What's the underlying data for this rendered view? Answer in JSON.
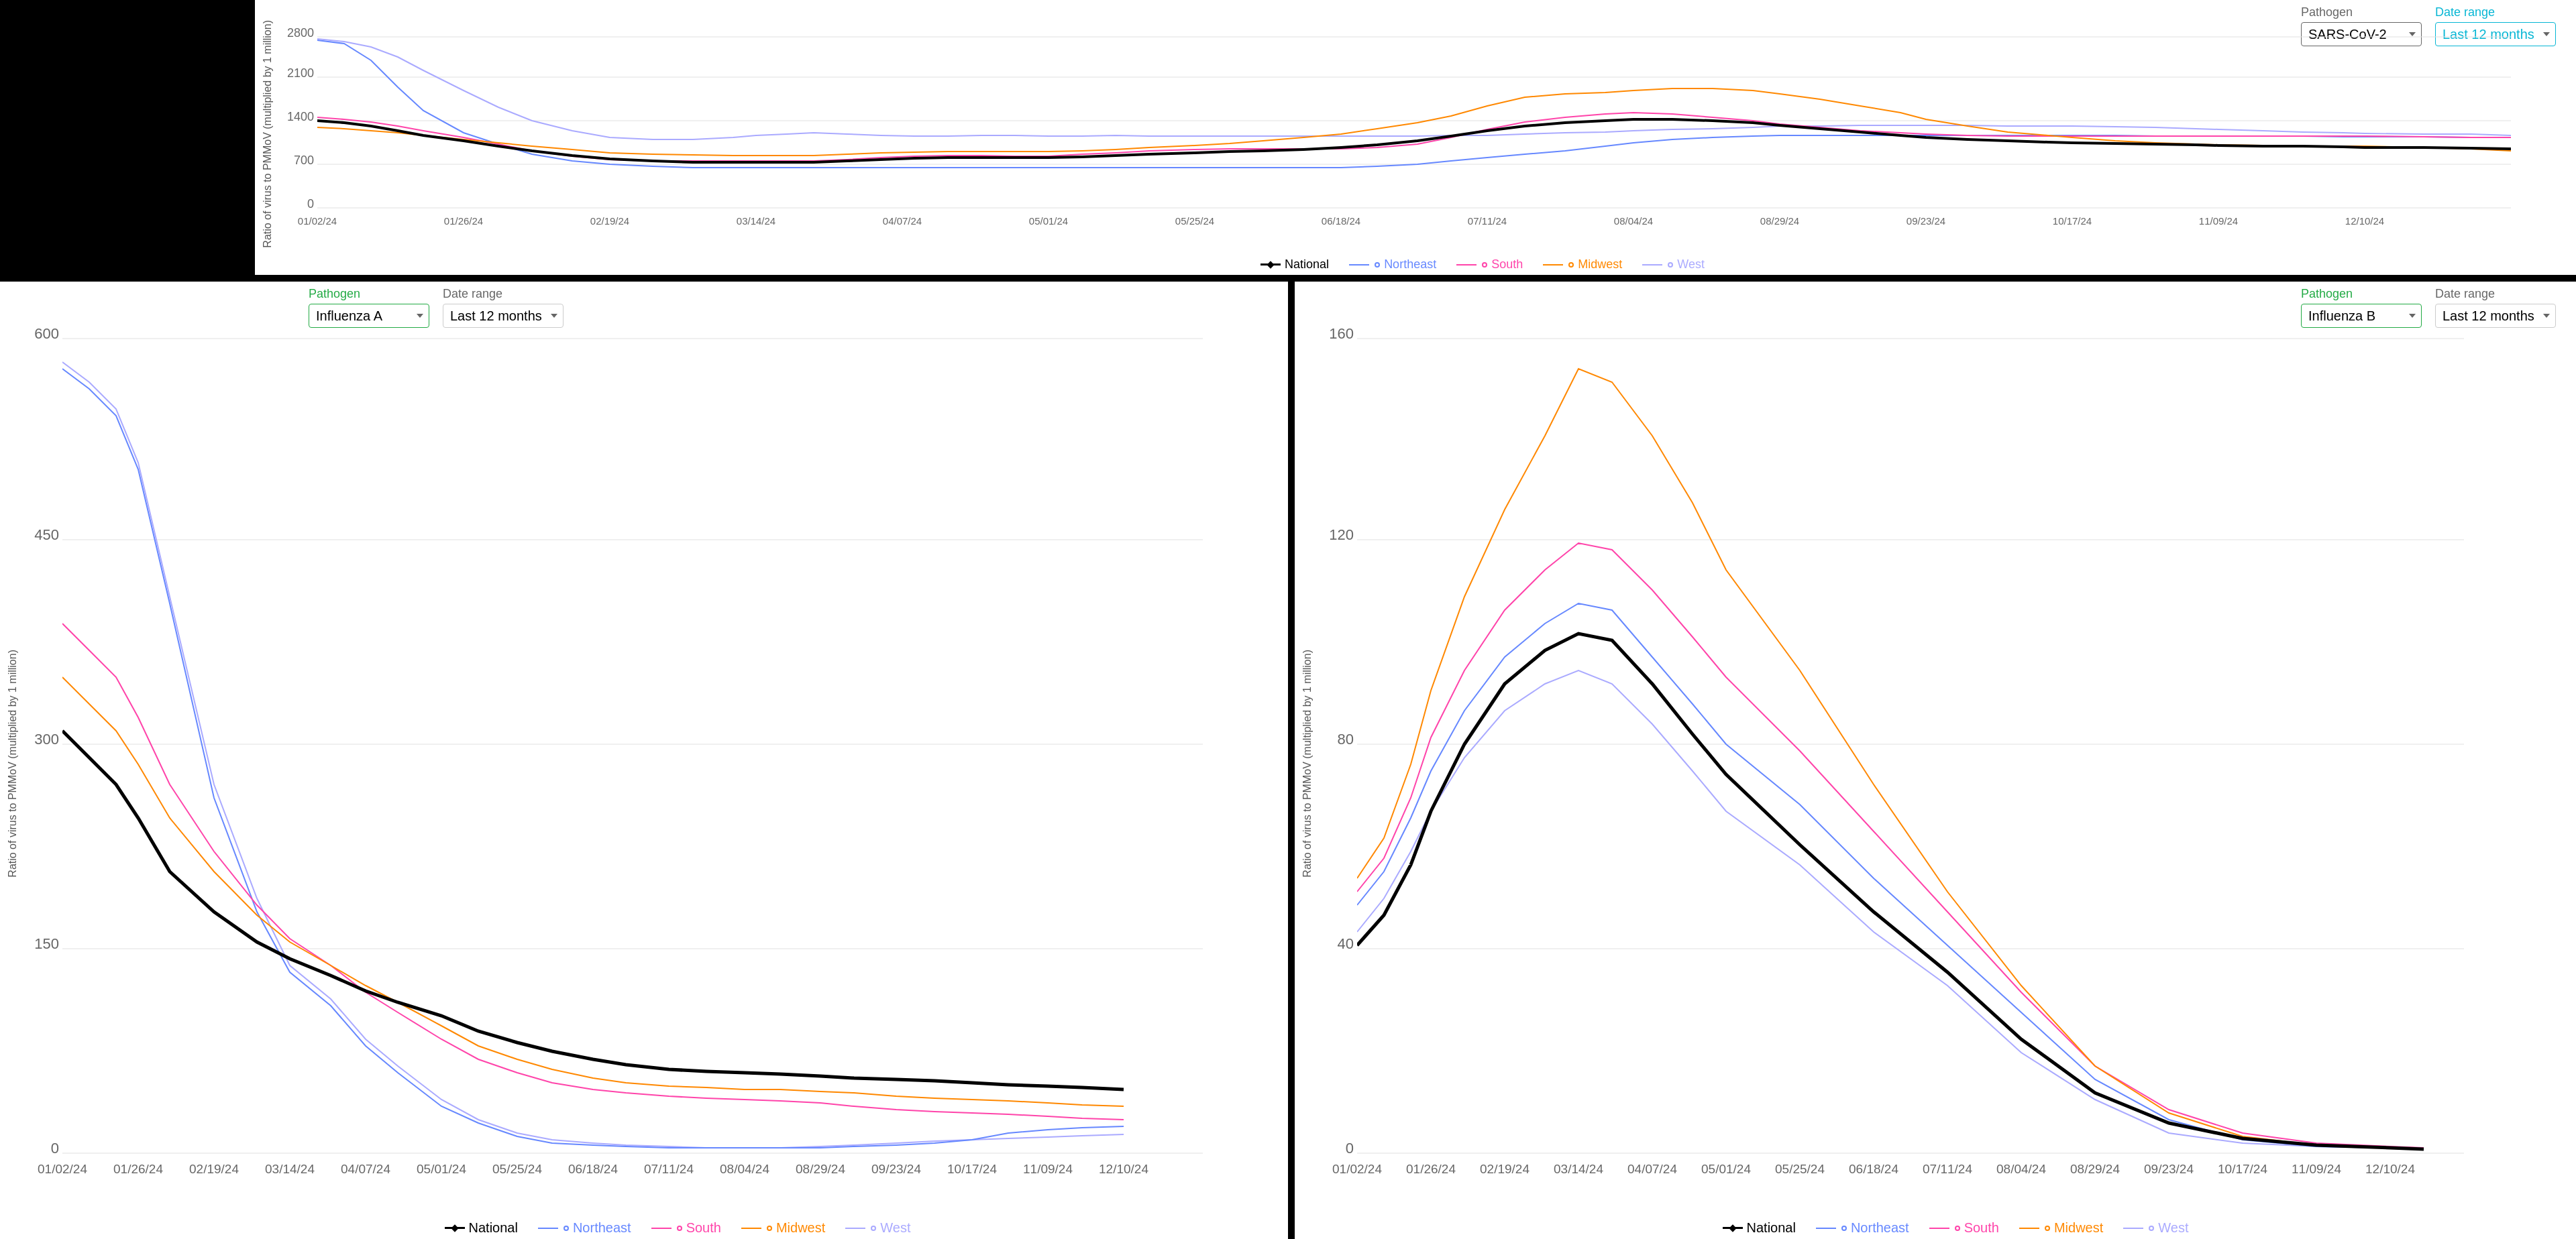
{
  "colors": {
    "national": "#000000",
    "northeast": "#8888ff",
    "south": "#ff00aa",
    "midwest": "#ff8800",
    "west": "#aaaaff",
    "pathogen_border": "#666666",
    "date_border": "#06b6d4",
    "date_text": "#06b6d4"
  },
  "top_chart": {
    "pathogen_label": "Pathogen",
    "pathogen_value": "SARS-CoV-2",
    "date_range_label": "Date range",
    "date_range_value": "Last 12 months",
    "y_axis_label": "Ratio of virus to PMMoV (multiplied by 1 million)",
    "y_ticks": [
      "0",
      "700",
      "1400",
      "2100",
      "2800"
    ],
    "x_ticks": [
      "01/02/24",
      "01/26/24",
      "02/19/24",
      "03/14/24",
      "04/07/24",
      "05/01/24",
      "05/25/24",
      "06/18/24",
      "07/11/24",
      "08/04/24",
      "08/29/24",
      "09/23/24",
      "10/17/24",
      "11/09/24",
      "12/10/24"
    ]
  },
  "bottom_left_chart": {
    "pathogen_label": "Pathogen",
    "pathogen_value": "Influenza A",
    "date_range_label": "Date range",
    "date_range_value": "Last 12 months",
    "y_axis_label": "Ratio of virus to PMMoV (multiplied by 1 million)",
    "y_ticks": [
      "0",
      "150",
      "300",
      "450",
      "600"
    ],
    "x_ticks": [
      "01/02/24",
      "01/26/24",
      "02/19/24",
      "03/14/24",
      "04/07/24",
      "05/01/24",
      "05/25/24",
      "06/18/24",
      "07/11/24",
      "08/04/24",
      "08/29/24",
      "09/23/24",
      "10/17/24",
      "11/09/24",
      "12/10/24"
    ]
  },
  "bottom_right_chart": {
    "pathogen_label": "Pathogen",
    "pathogen_value": "Influenza B",
    "date_range_label": "Date range",
    "date_range_value": "Last 12 months",
    "y_axis_label": "Ratio of virus to PMMoV (multiplied by 1 million)",
    "y_ticks": [
      "0",
      "40",
      "80",
      "120",
      "160"
    ],
    "x_ticks": [
      "01/02/24",
      "01/26/24",
      "02/19/24",
      "03/14/24",
      "04/07/24",
      "05/01/24",
      "05/25/24",
      "06/18/24",
      "07/11/24",
      "08/04/24",
      "08/29/24",
      "09/23/24",
      "10/17/24",
      "11/09/24",
      "12/10/24"
    ]
  },
  "legend": {
    "national": "National",
    "northeast": "Northeast",
    "south": "South",
    "midwest": "Midwest",
    "west": "West"
  }
}
